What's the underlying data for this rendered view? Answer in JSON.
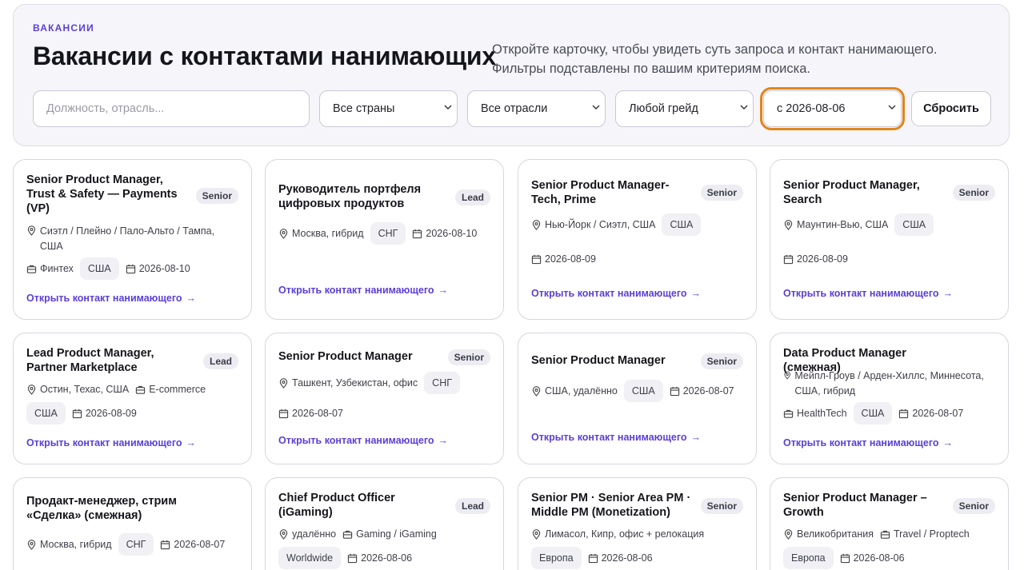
{
  "header": {
    "kicker": "ВАКАНСИИ",
    "title": "Вакансии с контактами нанимающих",
    "intro": "Откройте карточку, чтобы увидеть суть запроса и контакт нанимающего. Фильтры подставлены по вашим критериям поиска."
  },
  "filters": {
    "search_placeholder": "Должность, отрасль...",
    "country": "Все страны",
    "industry": "Все отрасли",
    "grade": "Любой грейд",
    "date": "с 2026-08-06",
    "reset_label": "Сбросить"
  },
  "link_label": "Открыть контакт нанимающего",
  "cards": [
    {
      "title": "Senior Product Manager, Trust & Safety — Payments (VP)",
      "badge": "Senior",
      "location": "Сиэтл / Плейно / Пало-Альто / Тампа, США",
      "industry": "Финтех",
      "region": "США",
      "date": "2026-08-10"
    },
    {
      "title": "Руководитель портфеля цифровых продуктов",
      "badge": "Lead",
      "location": "Москва, гибрид",
      "region": "СНГ",
      "date": "2026-08-10"
    },
    {
      "title": "Senior Product Manager-Tech, Prime",
      "badge": "Senior",
      "location": "Нью-Йорк / Сиэтл, США",
      "region": "США",
      "date": "2026-08-09"
    },
    {
      "title": "Senior Product Manager, Search",
      "badge": "Senior",
      "location": "Маунтин-Вью, США",
      "region": "США",
      "date": "2026-08-09"
    },
    {
      "title": "Lead Product Manager, Partner Marketplace",
      "badge": "Lead",
      "location": "Остин, Техас, США",
      "industry": "E-commerce",
      "region": "США",
      "date": "2026-08-09"
    },
    {
      "title": "Senior Product Manager",
      "badge": "Senior",
      "location": "Ташкент, Узбекистан, офис",
      "region": "СНГ",
      "date": "2026-08-07"
    },
    {
      "title": "Senior Product Manager",
      "badge": "Senior",
      "location": "США, удалённо",
      "region": "США",
      "date": "2026-08-07"
    },
    {
      "title": "Data Product Manager (смежная)",
      "location": "Мейпл-Гроув / Арден-Хиллс, Миннесота, США, гибрид",
      "industry": "HealthTech",
      "region": "США",
      "date": "2026-08-07"
    },
    {
      "title": "Продакт-менеджер, стрим «Сделка» (смежная)",
      "location": "Москва, гибрид",
      "region": "СНГ",
      "date": "2026-08-07"
    },
    {
      "title": "Chief Product Officer (iGaming)",
      "badge": "Lead",
      "location": "удалённо",
      "industry": "Gaming / iGaming",
      "region": "Worldwide",
      "date": "2026-08-06"
    },
    {
      "title": "Senior PM · Senior Area PM · Middle PM (Monetization)",
      "badge": "Senior",
      "location": "Лимасол, Кипр, офис + релокация",
      "region": "Европа",
      "date": "2026-08-06"
    },
    {
      "title": "Senior Product Manager – Growth",
      "badge": "Senior",
      "location": "Великобритания",
      "industry": "Travel / Proptech",
      "region": "Европа",
      "date": "2026-08-06"
    }
  ]
}
